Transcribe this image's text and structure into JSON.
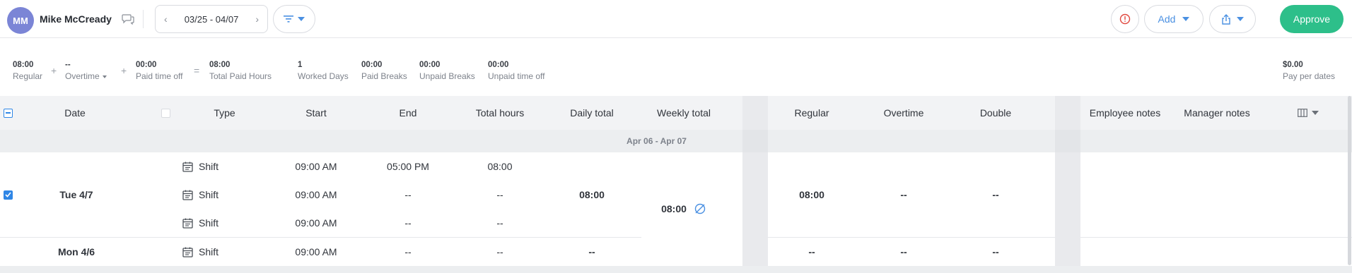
{
  "header": {
    "avatar_initials": "MM",
    "user_name": "Mike McCready",
    "date_range": "03/25 - 04/07",
    "add_label": "Add",
    "approve_label": "Approve",
    "icons": [
      "chat-icon",
      "chevron-left-icon",
      "chevron-right-icon",
      "filter-icon",
      "alert-icon",
      "share-icon"
    ]
  },
  "summary": {
    "regular": {
      "value": "08:00",
      "label": "Regular"
    },
    "overtime": {
      "value": "--",
      "label": "Overtime"
    },
    "paid_time_off": {
      "value": "00:00",
      "label": "Paid time off"
    },
    "total_paid_hours": {
      "value": "08:00",
      "label": "Total Paid Hours"
    },
    "worked_days": {
      "value": "1",
      "label": "Worked Days"
    },
    "paid_breaks": {
      "value": "00:00",
      "label": "Paid Breaks"
    },
    "unpaid_breaks": {
      "value": "00:00",
      "label": "Unpaid Breaks"
    },
    "unpaid_time_off": {
      "value": "00:00",
      "label": "Unpaid time off"
    },
    "pay_per_dates": {
      "value": "$0.00",
      "label": "Pay per dates"
    },
    "plus": "+",
    "equals": "="
  },
  "table": {
    "columns": {
      "date": "Date",
      "type": "Type",
      "start": "Start",
      "end": "End",
      "total_hours": "Total hours",
      "daily_total": "Daily total",
      "weekly_total": "Weekly total",
      "regular": "Regular",
      "overtime": "Overtime",
      "double": "Double",
      "employee_notes": "Employee notes",
      "manager_notes": "Manager notes"
    },
    "group_label": "Apr 06 - Apr 07",
    "weekly_total": "08:00",
    "rows": [
      {
        "date": "Tue 4/7",
        "checked": true,
        "daily_total": "08:00",
        "regular": "08:00",
        "overtime": "--",
        "double": "--",
        "shifts": [
          {
            "type": "Shift",
            "start": "09:00 AM",
            "end": "05:00 PM",
            "total": "08:00"
          },
          {
            "type": "Shift",
            "start": "09:00 AM",
            "end": "--",
            "total": "--"
          },
          {
            "type": "Shift",
            "start": "09:00 AM",
            "end": "--",
            "total": "--"
          }
        ]
      },
      {
        "date": "Mon 4/6",
        "checked": false,
        "daily_total": "--",
        "regular": "--",
        "overtime": "--",
        "double": "--",
        "shifts": [
          {
            "type": "Shift",
            "start": "09:00 AM",
            "end": "--",
            "total": "--"
          }
        ]
      }
    ]
  },
  "colors": {
    "accent": "#2f86e6",
    "approve": "#2dbf8a",
    "alert": "#e0473e",
    "avatar": "#7b85d6"
  }
}
